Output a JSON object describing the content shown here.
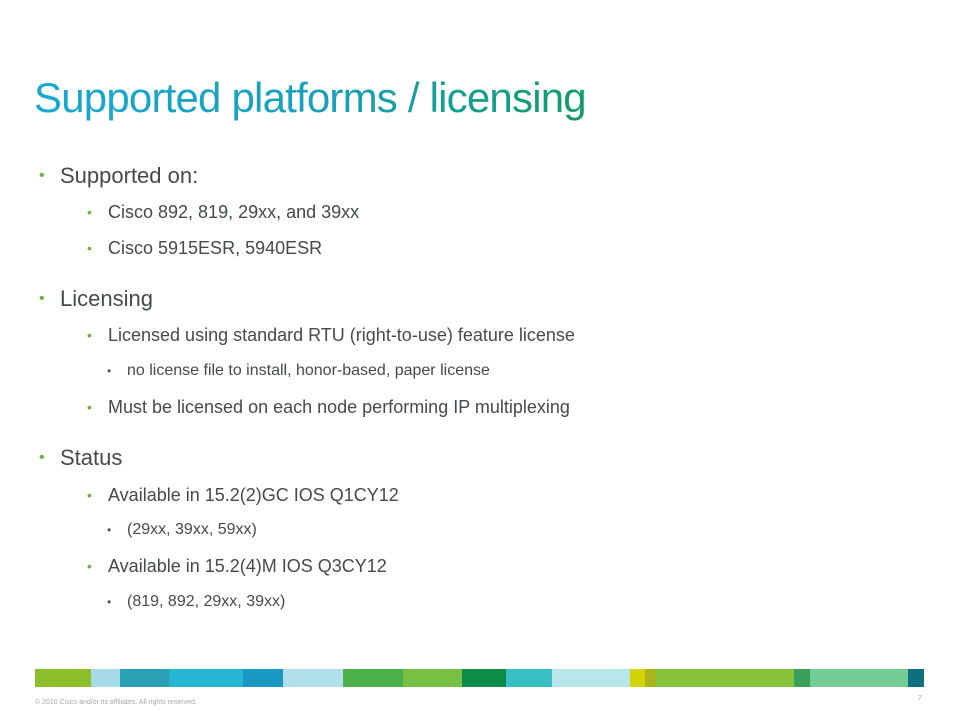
{
  "slide": {
    "title": "Supported platforms / licensing",
    "bullets": [
      {
        "text": "Supported on:",
        "children": [
          {
            "text": "Cisco 892, 819, 29xx, and 39xx"
          },
          {
            "text": "Cisco 5915ESR, 5940ESR"
          }
        ]
      },
      {
        "text": "Licensing",
        "children": [
          {
            "text": "Licensed using standard RTU (right-to-use) feature license",
            "children": [
              {
                "text": "no license file to install, honor-based, paper license"
              }
            ]
          },
          {
            "text": "Must be licensed on each node performing IP multiplexing"
          }
        ]
      },
      {
        "text": "Status",
        "children": [
          {
            "text": "Available in 15.2(2)GC IOS Q1CY12",
            "children": [
              {
                "text": "(29xx, 39xx, 59xx)"
              }
            ]
          },
          {
            "text": "Available in 15.2(4)M IOS Q3CY12",
            "children": [
              {
                "text": "(819, 892, 29xx, 39xx)"
              }
            ]
          }
        ]
      }
    ]
  },
  "footer": {
    "copyright": "© 2010 Cisco and/or its affiliates. All rights reserved.",
    "page_number": "7"
  },
  "colors": {
    "title_gradient": [
      "#19a8d0",
      "#139b6a"
    ],
    "bullet_dot": "#6cb33f",
    "body_text": "#444a4e",
    "band": [
      "#8dbf2c",
      "#a7dbe8",
      "#2ba0b5",
      "#26b6d4",
      "#1a98c4",
      "#b0e0ea",
      "#4ab04a",
      "#78c043",
      "#0e8a49",
      "#39c0c5",
      "#b8e6ea",
      "#d4d400",
      "#a9b51a",
      "#88c23a",
      "#3ca05a",
      "#73cc93",
      "#0d6f7f"
    ]
  }
}
